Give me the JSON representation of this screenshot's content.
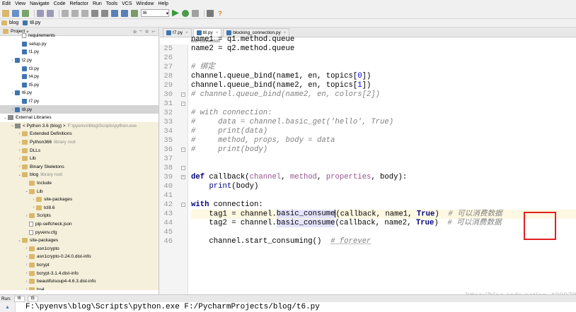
{
  "menu": [
    "Edit",
    "View",
    "Navigate",
    "Code",
    "Refactor",
    "Run",
    "Tools",
    "VCS",
    "Window",
    "Help"
  ],
  "toolbar": {
    "run_config": "t6"
  },
  "breadcrumb": [
    "blog",
    "t8.py"
  ],
  "project_panel": {
    "title": "Project"
  },
  "tree": [
    {
      "indent": 2,
      "arrow": "",
      "icon": "file",
      "label": "requirements",
      "hint": ""
    },
    {
      "indent": 2,
      "arrow": "",
      "icon": "py",
      "label": "setup.py",
      "hint": ""
    },
    {
      "indent": 2,
      "arrow": "",
      "icon": "py",
      "label": "t1.py",
      "hint": ""
    },
    {
      "indent": 1,
      "arrow": "›",
      "icon": "py",
      "label": "t2.py",
      "hint": ""
    },
    {
      "indent": 2,
      "arrow": "",
      "icon": "py",
      "label": "t3.py",
      "hint": ""
    },
    {
      "indent": 2,
      "arrow": "",
      "icon": "py",
      "label": "t4.py",
      "hint": ""
    },
    {
      "indent": 2,
      "arrow": "",
      "icon": "py",
      "label": "t5.py",
      "hint": ""
    },
    {
      "indent": 1,
      "arrow": "›",
      "icon": "py",
      "label": "t6.py",
      "hint": ""
    },
    {
      "indent": 2,
      "arrow": "",
      "icon": "py",
      "label": "t7.py",
      "hint": ""
    },
    {
      "indent": 1,
      "arrow": "›",
      "icon": "py",
      "label": "t8.py",
      "hint": "",
      "selected": true
    },
    {
      "indent": 0,
      "arrow": "⌄",
      "icon": "lib",
      "label": "External Libraries",
      "hint": ""
    },
    {
      "indent": 1,
      "arrow": "⌄",
      "icon": "lib",
      "label": "< Python 3.6 (blog) >",
      "hint": "F:\\pyenvs\\blog\\Scripts\\python.exe",
      "lib": true
    },
    {
      "indent": 2,
      "arrow": "›",
      "icon": "folder",
      "label": "Extended Definitions",
      "hint": "",
      "lib": true
    },
    {
      "indent": 2,
      "arrow": "›",
      "icon": "folder",
      "label": "Python366",
      "hint": "library root",
      "lib": true
    },
    {
      "indent": 2,
      "arrow": "›",
      "icon": "folder",
      "label": "DLLs",
      "hint": "",
      "lib": true
    },
    {
      "indent": 2,
      "arrow": "›",
      "icon": "folder",
      "label": "Lib",
      "hint": "",
      "lib": true
    },
    {
      "indent": 2,
      "arrow": "›",
      "icon": "folder",
      "label": "Binary Skeletons",
      "hint": "",
      "lib": true
    },
    {
      "indent": 2,
      "arrow": "⌄",
      "icon": "folder",
      "label": "blog",
      "hint": "library root",
      "lib": true
    },
    {
      "indent": 3,
      "arrow": "",
      "icon": "folder",
      "label": "Include",
      "hint": "",
      "lib": true
    },
    {
      "indent": 3,
      "arrow": "⌄",
      "icon": "folder",
      "label": "Lib",
      "hint": "",
      "lib": true
    },
    {
      "indent": 4,
      "arrow": "›",
      "icon": "folder",
      "label": "site-packages",
      "hint": "",
      "lib": true
    },
    {
      "indent": 4,
      "arrow": "›",
      "icon": "folder",
      "label": "tcl8.6",
      "hint": "",
      "lib": true
    },
    {
      "indent": 3,
      "arrow": "›",
      "icon": "folder",
      "label": "Scripts",
      "hint": "",
      "lib": true
    },
    {
      "indent": 3,
      "arrow": "",
      "icon": "file",
      "label": "pip-selfcheck.json",
      "hint": "",
      "lib": true
    },
    {
      "indent": 3,
      "arrow": "",
      "icon": "file",
      "label": "pyvenv.cfg",
      "hint": "",
      "lib": true
    },
    {
      "indent": 2,
      "arrow": "⌄",
      "icon": "folder",
      "label": "site-packages",
      "hint": "",
      "lib": true
    },
    {
      "indent": 3,
      "arrow": "›",
      "icon": "folder",
      "label": "asn1crypto",
      "hint": "",
      "lib": true
    },
    {
      "indent": 3,
      "arrow": "›",
      "icon": "folder",
      "label": "asn1crypto-0.24.0.dist-info",
      "hint": "",
      "lib": true
    },
    {
      "indent": 3,
      "arrow": "›",
      "icon": "folder",
      "label": "bcrypt",
      "hint": "",
      "lib": true
    },
    {
      "indent": 3,
      "arrow": "›",
      "icon": "folder",
      "label": "bcrypt-3.1.4.dist-info",
      "hint": "",
      "lib": true
    },
    {
      "indent": 3,
      "arrow": "›",
      "icon": "folder",
      "label": "beautifulsoup4-4.6.3.dist-info",
      "hint": "",
      "lib": true
    },
    {
      "indent": 3,
      "arrow": "›",
      "icon": "folder",
      "label": "bs4",
      "hint": "",
      "lib": true
    }
  ],
  "tabs": [
    {
      "label": "t7.py",
      "active": false
    },
    {
      "label": "t8.py",
      "active": true
    },
    {
      "label": "blocking_connection.py",
      "active": false
    }
  ],
  "editor": {
    "context_hint": "with connection",
    "line_numbers": [
      "25",
      "26",
      "27",
      "28",
      "29",
      "30",
      "31",
      "32",
      "33",
      "34",
      "35",
      "36",
      "37",
      "38",
      "39",
      "40",
      "41",
      "42",
      "43",
      "44",
      "45",
      "46"
    ],
    "comment_bind": "# 绑定",
    "comment_consume": "# 可以消费数据",
    "comment_forever": "# forever"
  },
  "watermark": "https://blog.csdn.net/qq_42227818",
  "run_panel": {
    "label": "Run:",
    "tabs": [
      "t6",
      "t5"
    ],
    "console_line": "F:\\pyenvs\\blog\\Scripts\\python.exe F:/PycharmProjects/blog/t6.py"
  }
}
